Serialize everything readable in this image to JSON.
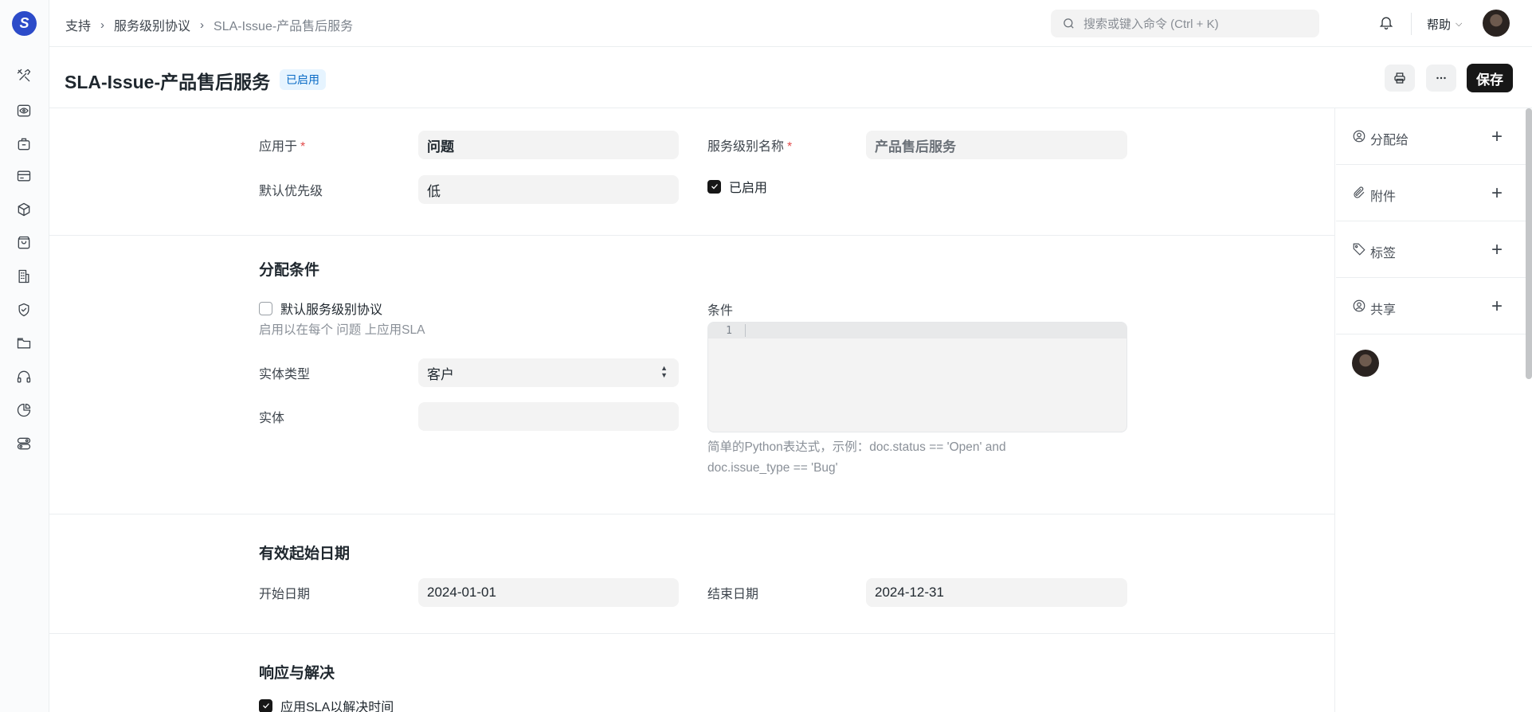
{
  "breadcrumb": {
    "items": [
      "支持",
      "服务级别协议",
      "SLA-Issue-产品售后服务"
    ]
  },
  "search": {
    "placeholder": "搜索或键入命令 (Ctrl + K)"
  },
  "navbar": {
    "help_label": "帮助"
  },
  "page": {
    "title": "SLA-Issue-产品售后服务",
    "status": "已启用",
    "save_label": "保存"
  },
  "form": {
    "apply_to_label": "应用于",
    "apply_to_value": "问题",
    "sla_name_label": "服务级别名称",
    "sla_name_value": "产品售后服务",
    "default_priority_label": "默认优先级",
    "default_priority_value": "低",
    "enabled_label": "已启用",
    "enabled_checked": true
  },
  "assignment": {
    "title": "分配条件",
    "default_sla_label": "默认服务级别协议",
    "default_sla_checked": false,
    "default_sla_help": "启用以在每个 问题 上应用SLA",
    "entity_type_label": "实体类型",
    "entity_type_value": "客户",
    "entity_label": "实体",
    "entity_value": "",
    "condition_label": "条件",
    "condition_line_number": "1",
    "condition_help_line1": "简单的Python表达式，示例：doc.status == 'Open' and",
    "condition_help_line2": "doc.issue_type == 'Bug'"
  },
  "validity": {
    "title": "有效起始日期",
    "start_label": "开始日期",
    "start_value": "2024-01-01",
    "end_label": "结束日期",
    "end_value": "2024-12-31"
  },
  "response": {
    "title": "响应与解决",
    "apply_sla_label": "应用SLA以解决时间",
    "apply_sla_checked": true
  },
  "sidepanel": {
    "assign_label": "分配给",
    "attachments_label": "附件",
    "tags_label": "标签",
    "share_label": "共享"
  },
  "sidebar_icons": [
    "tools-icon",
    "eye-icon",
    "briefcase-icon",
    "card-icon",
    "box-icon",
    "bag-icon",
    "building-icon",
    "shield-icon",
    "folder-icon",
    "headset-icon",
    "pie-chart-icon",
    "toggles-icon"
  ],
  "colors": {
    "accent": "#2c4bc9",
    "status_badge_bg": "#e6f4ff",
    "status_badge_text": "#0a6bc6",
    "primary_button": "#171717"
  }
}
